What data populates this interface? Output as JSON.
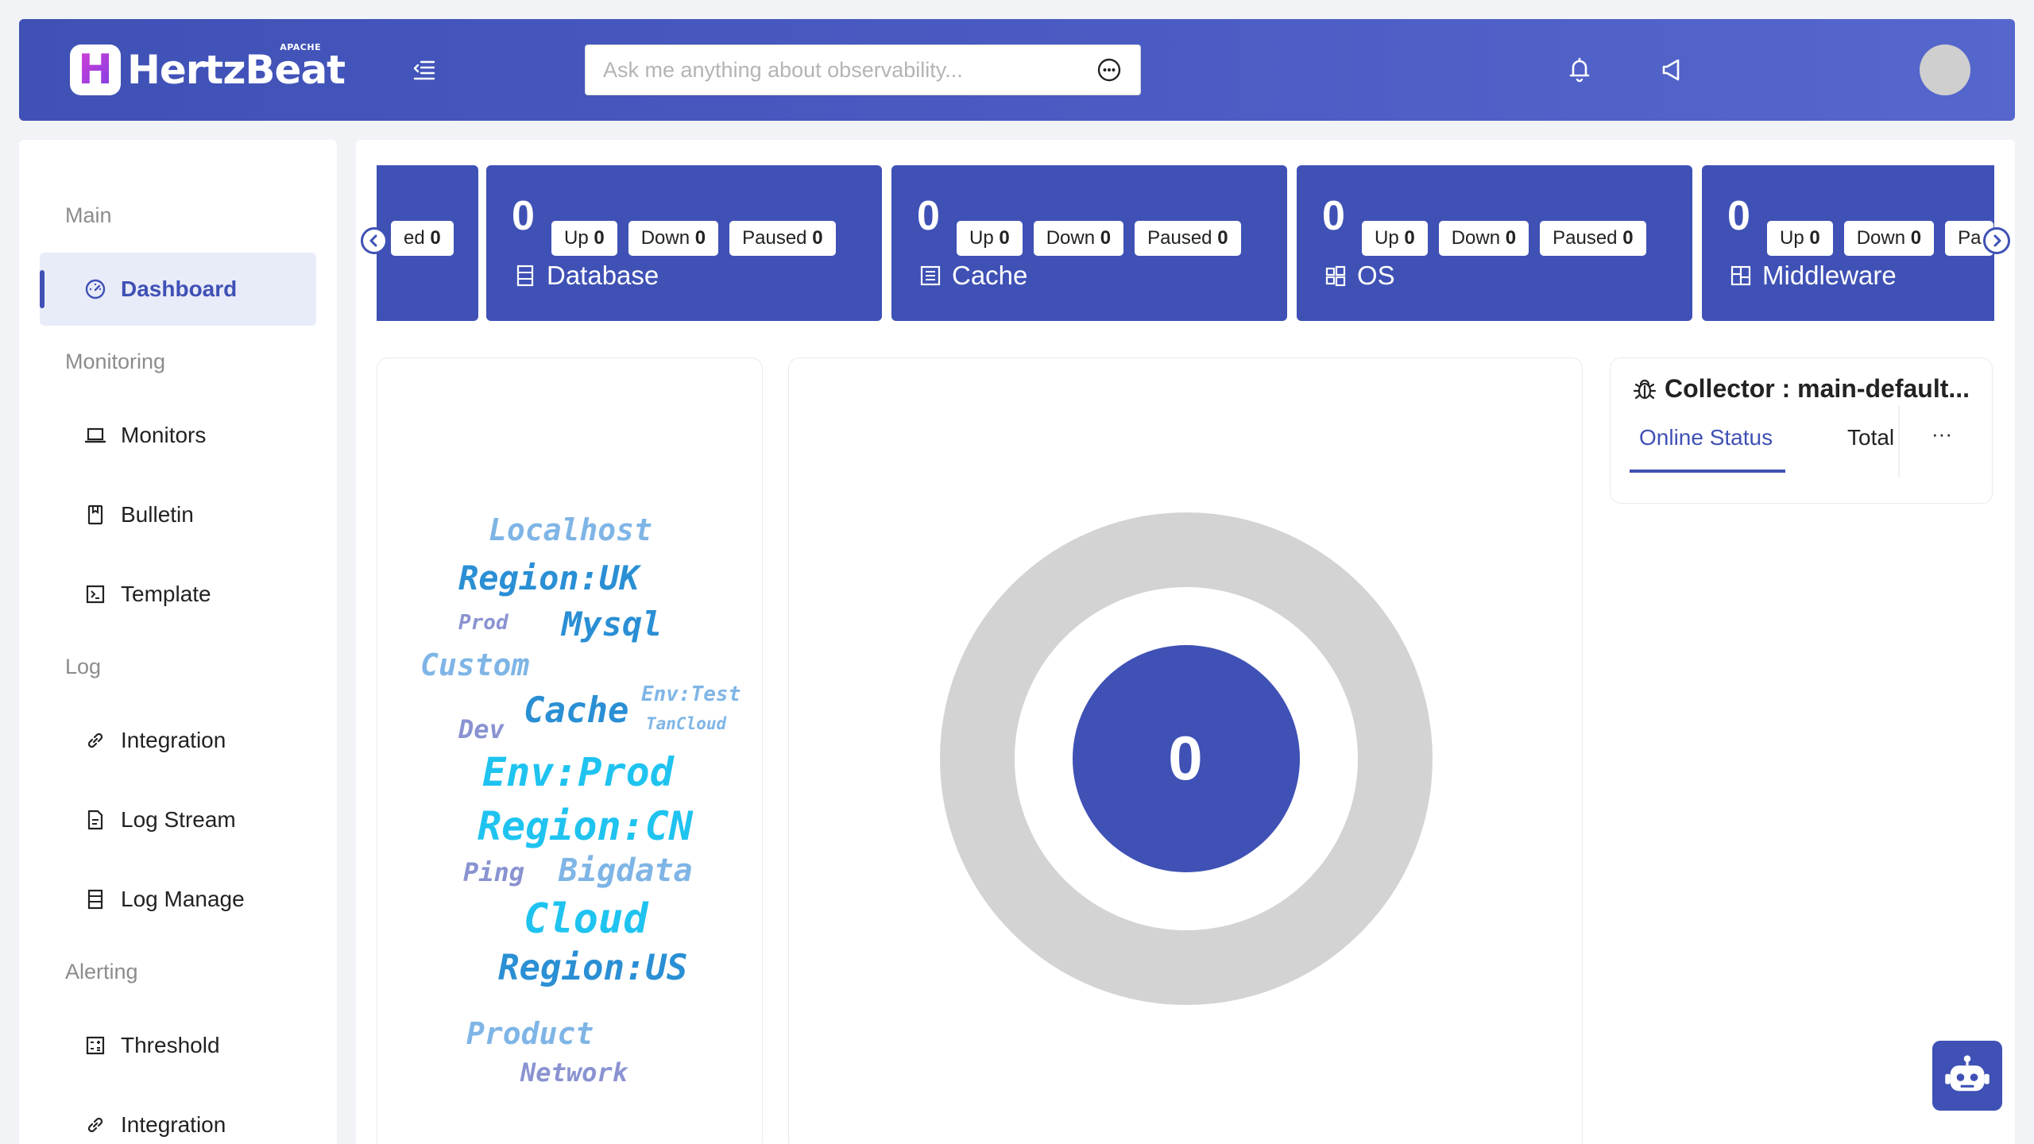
{
  "header": {
    "logo_text": "HertzBeat",
    "logo_badge": "APACHE",
    "search_placeholder": "Ask me anything about observability...",
    "icons": [
      "menu-fold-icon",
      "chat-icon",
      "bell-icon",
      "notification-sound-icon"
    ]
  },
  "sidebar": {
    "groups": {
      "main": "Main",
      "monitoring": "Monitoring",
      "log": "Log",
      "alerting": "Alerting"
    },
    "items": [
      {
        "label": "Dashboard",
        "icon": "dashboard-icon"
      },
      {
        "label": "Monitors",
        "icon": "laptop-icon"
      },
      {
        "label": "Bulletin",
        "icon": "book-icon"
      },
      {
        "label": "Template",
        "icon": "code-icon"
      },
      {
        "label": "Integration",
        "icon": "link-icon"
      },
      {
        "label": "Log Stream",
        "icon": "file-text-icon"
      },
      {
        "label": "Log Manage",
        "icon": "database-icon"
      },
      {
        "label": "Threshold",
        "icon": "calculator-icon"
      },
      {
        "label": "Integration",
        "icon": "link-icon"
      }
    ]
  },
  "cards": [
    {
      "partial_tag": "ed",
      "partial_value": "0"
    },
    {
      "name": "Database",
      "count": "0",
      "up_label": "Up",
      "up": "0",
      "down_label": "Down",
      "down": "0",
      "paused_label": "Paused",
      "paused": "0",
      "icon": "database-icon"
    },
    {
      "name": "Cache",
      "count": "0",
      "up_label": "Up",
      "up": "0",
      "down_label": "Down",
      "down": "0",
      "paused_label": "Paused",
      "paused": "0",
      "icon": "cache-icon"
    },
    {
      "name": "OS",
      "count": "0",
      "up_label": "Up",
      "up": "0",
      "down_label": "Down",
      "down": "0",
      "paused_label": "Paused",
      "paused": "0",
      "icon": "windows-icon"
    },
    {
      "name": "Middleware",
      "count": "0",
      "up_label": "Up",
      "up": "0",
      "down_label": "Down",
      "down": "0",
      "paused_label": "Pa",
      "icon": "layout-icon"
    }
  ],
  "wordcloud": {
    "words": [
      {
        "text": "Localhost",
        "color": "#7fb5e6"
      },
      {
        "text": "Region:UK",
        "color": "#2a8fd4"
      },
      {
        "text": "Prod",
        "color": "#8a93d1"
      },
      {
        "text": "Mysql",
        "color": "#2a8fd4"
      },
      {
        "text": "Custom",
        "color": "#7fb5e6"
      },
      {
        "text": "Env:Test",
        "color": "#7fb5e6"
      },
      {
        "text": "Cache",
        "color": "#2a8fd4"
      },
      {
        "text": "TanCloud",
        "color": "#7fb5e6"
      },
      {
        "text": "Dev",
        "color": "#8a93d1"
      },
      {
        "text": "Env:Prod",
        "color": "#1fc3f0"
      },
      {
        "text": "Region:CN",
        "color": "#1fc3f0"
      },
      {
        "text": "Ping",
        "color": "#8a93d1"
      },
      {
        "text": "Bigdata",
        "color": "#7fb5e6"
      },
      {
        "text": "Cloud",
        "color": "#1fc3f0"
      },
      {
        "text": "Region:US",
        "color": "#2a8fd4"
      },
      {
        "text": "Product",
        "color": "#7fb5e6"
      },
      {
        "text": "Network",
        "color": "#8a93d1"
      }
    ]
  },
  "donut": {
    "value": "0",
    "color_center": "#3f51b5",
    "color_ring": "#d3d3d3"
  },
  "collector": {
    "title": "Collector : main-default...",
    "tabs": [
      "Online Status",
      "Total"
    ],
    "more": "···"
  },
  "colors": {
    "accent": "#3f51b5"
  }
}
